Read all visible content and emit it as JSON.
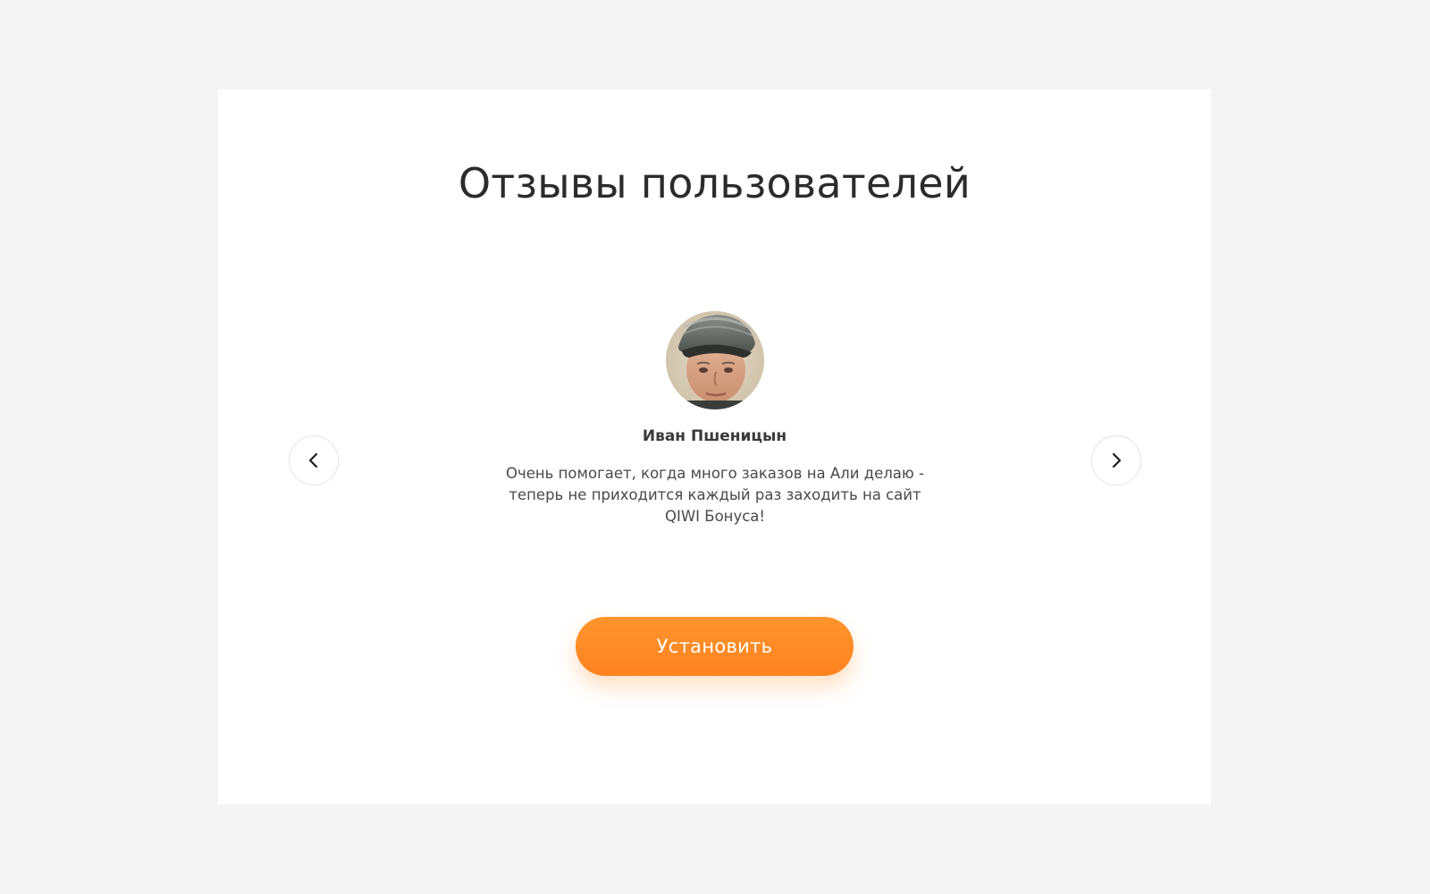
{
  "reviews": {
    "title": "Отзывы пользователей",
    "current": {
      "name": "Иван Пшеницын",
      "text": "Очень помогает, когда много заказов на Али делаю - теперь не приходится каждый раз заходить на сайт QIWI Бонуса!"
    },
    "nav": {
      "prev_icon": "chevron-left-icon",
      "next_icon": "chevron-right-icon"
    }
  },
  "cta": {
    "install_label": "Установить"
  },
  "colors": {
    "page_background": "#f4f4f4",
    "card_background": "#ffffff",
    "accent": "#ff8c26",
    "title_text": "#2b2b2b"
  }
}
